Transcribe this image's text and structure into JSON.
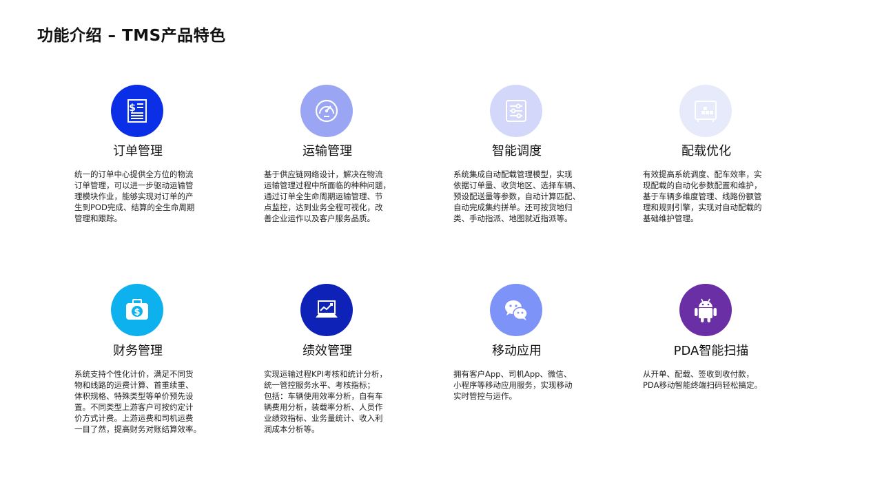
{
  "page": {
    "title": "功能介绍 – TMS产品特色"
  },
  "features": [
    {
      "title": "订单管理",
      "icon": "invoice-dollar-icon",
      "color": "#0a2fe6",
      "desc": "统一的订单中心提供全方位的物流\n订单管理，可以进一步驱动运输管\n理模块作业，能够实现对订单的产\n生到POD完成、结算的全生命周期\n管理和跟踪。"
    },
    {
      "title": "运输管理",
      "icon": "speedometer-icon",
      "color": "#9aa6f3",
      "desc": "基于供应链网络设计，解决在物流\n运输管理过程中所面临的种种问题，\n通过订单全生命周期运输管理、节\n点监控，达到业务全程可视化，改\n善企业运作以及客户服务品质。"
    },
    {
      "title": "智能调度",
      "icon": "sliders-icon",
      "color": "#d3d8fa",
      "desc": "系统集成自动配载管理模型，实现\n依据订单量、收货地区、选择车辆、\n预设配送量等参数，自动计算匹配、\n自动完成集约拼单。还可按货地归\n类、手动指派、地图就近指派等。"
    },
    {
      "title": "配载优化",
      "icon": "cargo-box-icon",
      "color": "#e7eafb",
      "desc": "有效提高系统调度、配车效率，实\n现配载的自动化参数配置和维护，\n基于车辆多维度管理、线路份额管\n理和规则引擎，实现对自动配载的\n基础维护管理。"
    },
    {
      "title": "财务管理",
      "icon": "money-bag-icon",
      "color": "#0db1ee",
      "desc": "系统支持个性化计价，满足不同货\n物和线路的运费计算、首重续重、\n体积规格、特殊类型等单价预先设\n置。不同类型上游客户可按约定计\n价方式计费。上游运费和司机运费\n一目了然，提高财务对账结算效率。"
    },
    {
      "title": "绩效管理",
      "icon": "laptop-chart-icon",
      "color": "#0f22b8",
      "desc": "实现运输过程KPI考核和统计分析，\n统一管控服务水平、考核指标；\n包括：车辆使用效率分析，自有车\n辆费用分析，装载率分析、人员作\n业绩效指标、业务量统计、收入利\n润成本分析等。"
    },
    {
      "title": "移动应用",
      "icon": "wechat-icon",
      "color": "#7d93f7",
      "desc": "拥有客户App、司机App、微信、\n小程序等移动应用服务，实现移动\n实时管控与运作。"
    },
    {
      "title": "PDA智能扫描",
      "icon": "android-icon",
      "color": "#6a2ea5",
      "desc": "从开单、配载、签收到收付款，\nPDA移动智能终端扫码轻松搞定。"
    }
  ]
}
